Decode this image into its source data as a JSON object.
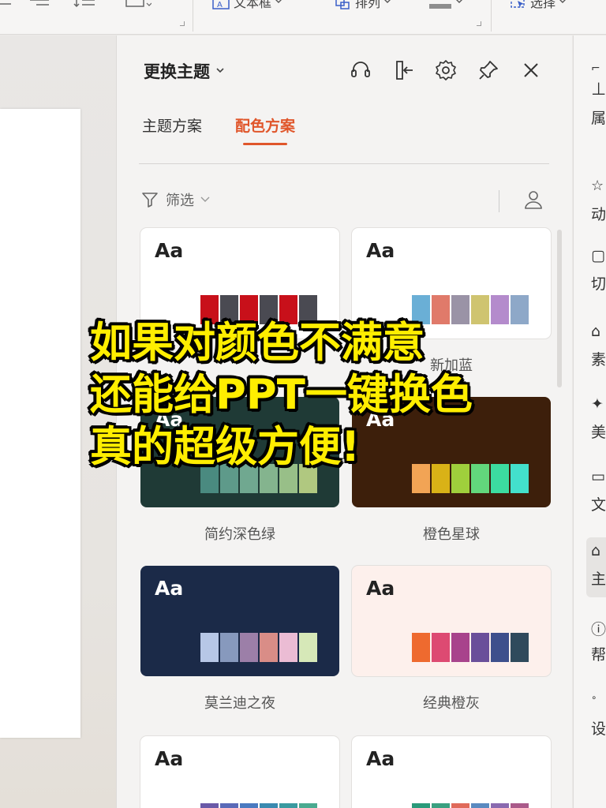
{
  "toolbar": {
    "textbox_label": "文本框",
    "arrange_label": "排列",
    "select_label": "选择"
  },
  "panel": {
    "title": "更换主题",
    "tabs": [
      {
        "label": "主题方案",
        "active": false
      },
      {
        "label": "配色方案",
        "active": true
      }
    ],
    "filter_label": "筛选"
  },
  "cards": [
    {
      "label": "",
      "bg": "#ffffff",
      "aa_color": "#222222",
      "colors": [
        "#c8101a",
        "#4a4a52",
        "#c8101a",
        "#4a4a52",
        "#c8101a",
        "#4a4a52"
      ]
    },
    {
      "label": "新加蓝",
      "bg": "#ffffff",
      "aa_color": "#222222",
      "colors": [
        "#6aafd6",
        "#e07a6a",
        "#9a93a6",
        "#cfc470",
        "#b48bcc",
        "#8ea8c8"
      ]
    },
    {
      "label": "简约深色绿",
      "bg": "#1f3a36",
      "aa_color": "#ffffff",
      "colors": [
        "#4a8a80",
        "#5e9a8a",
        "#70a890",
        "#84b48e",
        "#98bf88",
        "#b0c880"
      ]
    },
    {
      "label": "橙色星球",
      "bg": "#3d1f0b",
      "aa_color": "#ffffff",
      "colors": [
        "#f2a455",
        "#d9b217",
        "#9fcf3c",
        "#62d77c",
        "#3cdca0",
        "#43e0cc"
      ]
    },
    {
      "label": "莫兰迪之夜",
      "bg": "#1b2a48",
      "aa_color": "#ffffff",
      "colors": [
        "#b7c7e6",
        "#8799bd",
        "#9c7fa8",
        "#d98d87",
        "#ebbcd4",
        "#d6e8b8"
      ]
    },
    {
      "label": "经典橙灰",
      "bg": "#fdf0ec",
      "aa_color": "#222222",
      "colors": [
        "#ee6a2f",
        "#dd4a72",
        "#a8438c",
        "#6a4f9a",
        "#3d4f8c",
        "#2f4a5c"
      ]
    },
    {
      "label": "",
      "bg": "#ffffff",
      "aa_color": "#222222",
      "colors": [
        "#6a5aa8",
        "#5a6ab8",
        "#4a7ac0",
        "#3a8ab0",
        "#3a9aa0",
        "#4aaa90"
      ]
    },
    {
      "label": "",
      "bg": "#ffffff",
      "aa_color": "#222222",
      "colors": [
        "#2a9a7a",
        "#3aa080",
        "#e06a5a",
        "#5a8ac0",
        "#8a6ab0",
        "#aa5a8a"
      ]
    }
  ],
  "card_aa_text": "Aa",
  "rail": {
    "items": [
      "属",
      "动",
      "切",
      "素",
      "美",
      "文",
      "主",
      "帮",
      "设"
    ]
  },
  "caption": {
    "line1": "如果对颜色不满意",
    "line2": "还能给PPT一键换色",
    "line3": "真的超级方便!"
  }
}
